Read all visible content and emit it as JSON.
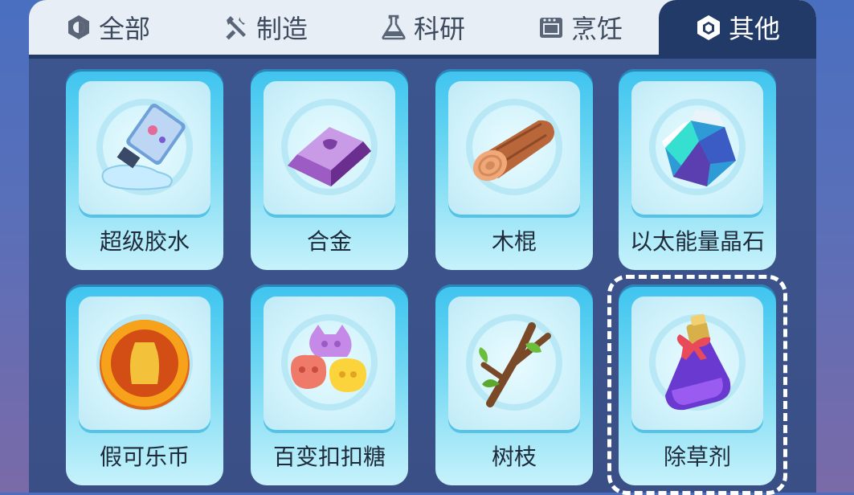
{
  "tabs": [
    {
      "label": "全部",
      "icon": "all-hexagon-icon"
    },
    {
      "label": "制造",
      "icon": "tools-icon"
    },
    {
      "label": "科研",
      "icon": "flask-icon"
    },
    {
      "label": "烹饪",
      "icon": "stove-icon"
    },
    {
      "label": "其他",
      "icon": "cube-icon"
    }
  ],
  "active_tab": "其他",
  "items": [
    {
      "name": "超级胶水",
      "icon": "glue-tube-icon"
    },
    {
      "name": "合金",
      "icon": "alloy-ingot-icon"
    },
    {
      "name": "木棍",
      "icon": "wood-log-icon"
    },
    {
      "name": "以太能量晶石",
      "icon": "ether-crystal-icon"
    },
    {
      "name": "假可乐币",
      "icon": "coin-icon"
    },
    {
      "name": "百变扣扣糖",
      "icon": "gummy-candy-icon"
    },
    {
      "name": "树枝",
      "icon": "tree-branch-icon"
    },
    {
      "name": "除草剂",
      "icon": "potion-bottle-icon"
    }
  ],
  "selected_item": "除草剂",
  "colors": {
    "active_tab_bg": "#223a67",
    "card_top": "#3ec4ef",
    "panel_bg": "#3d5690"
  }
}
